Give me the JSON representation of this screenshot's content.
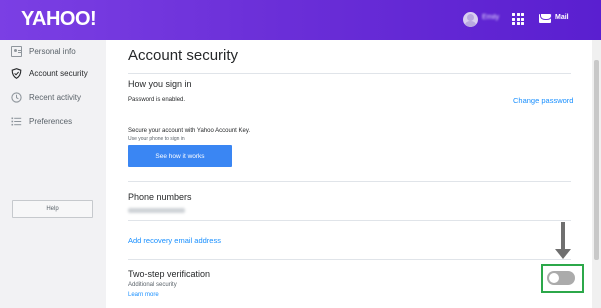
{
  "header": {
    "logo": "YAHOO!",
    "user_name": "Emily",
    "mail_label": "Mail",
    "icons": [
      "avatar",
      "apps-grid-icon",
      "mail-icon"
    ]
  },
  "sidebar": {
    "items": [
      {
        "label": "Personal info",
        "icon": "person-card-icon",
        "active": false
      },
      {
        "label": "Account security",
        "icon": "shield-icon",
        "active": true
      },
      {
        "label": "Recent activity",
        "icon": "clock-icon",
        "active": false
      },
      {
        "label": "Preferences",
        "icon": "list-icon",
        "active": false
      }
    ],
    "help_label": "Help"
  },
  "main": {
    "title": "Account security",
    "sign_in": {
      "heading": "How you sign in",
      "password_status": "Password is enabled.",
      "change_password": "Change password",
      "key_text": "Secure your account with Yahoo Account Key.",
      "key_subtext": "Use your phone to sign in",
      "key_button": "See how it works"
    },
    "phone": {
      "heading": "Phone numbers"
    },
    "recovery": {
      "link": "Add recovery email address"
    },
    "two_step": {
      "heading": "Two-step verification",
      "subtext": "Additional security",
      "learn_more": "Learn more",
      "enabled": false
    }
  },
  "colors": {
    "header_gradient_start": "#7b3fe4",
    "header_gradient_end": "#5a1fd0",
    "link": "#188fff",
    "button": "#3a86f3",
    "highlight": "#2ca84a",
    "arrow": "#6f6f6f"
  }
}
